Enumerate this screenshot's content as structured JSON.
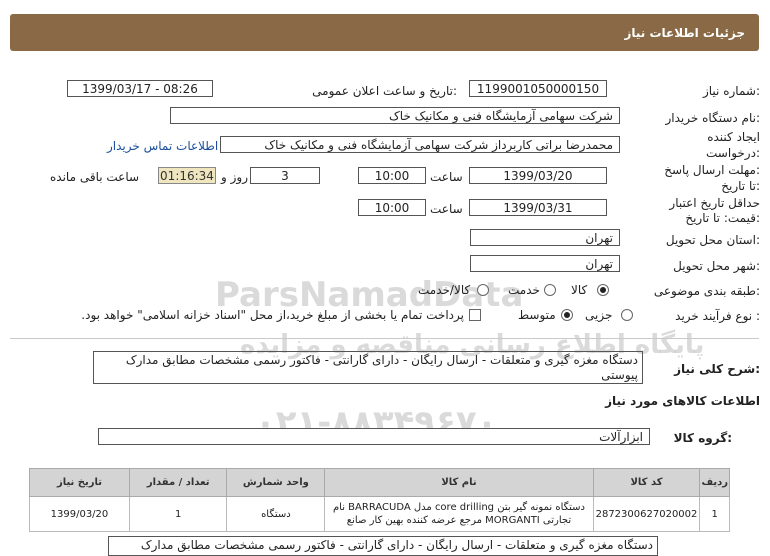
{
  "header": {
    "title": "جزئیات اطلاعات نیاز"
  },
  "fields": {
    "need_number": {
      "label": "شماره نیاز:",
      "value": "1199001050000150"
    },
    "announce_datetime": {
      "label": "تاریخ و ساعت اعلان عمومی:",
      "value": "1399/03/17 - 08:26"
    },
    "buyer_org": {
      "label": "نام دستگاه خریدار:",
      "value": "شرکت سهامی آزمایشگاه فنی و مکانیک خاک"
    },
    "requester": {
      "label_line1": "ایجاد کننده",
      "label_line2": "درخواست:",
      "value": "محمدرضا براتی کاربرداز  شرکت سهامی آزمایشگاه فنی و مکانیک خاک"
    },
    "buyer_contact_link": "اطلاعات تماس خریدار",
    "reply_deadline": {
      "label_line1": "مهلت ارسال پاسخ:",
      "label_line2": "تا تاریخ:",
      "date": "1399/03/20",
      "time_label": "ساعت",
      "time": "10:00",
      "days": "3",
      "days_label": "روز و",
      "remaining": "01:16:34",
      "remaining_label": "ساعت باقی مانده"
    },
    "price_validity": {
      "label_line1": "حداقل تاریخ اعتبار",
      "label_line2": "قیمت: تا تاریخ:",
      "date": "1399/03/31",
      "time_label": "ساعت",
      "time": "10:00"
    },
    "delivery_province": {
      "label": "استان محل تحویل:",
      "value": "تهران"
    },
    "delivery_city": {
      "label": "شهر محل تحویل:",
      "value": "تهران"
    },
    "category": {
      "label": "طبقه بندی موضوعی:",
      "options": [
        "کالا",
        "خدمت",
        "کالا/خدمت"
      ]
    },
    "purchase_process": {
      "label": "نوع فرآیند خرید :",
      "options": [
        "جزیی",
        "متوسط"
      ],
      "note": "پرداخت تمام یا بخشی از مبلغ خرید،از محل \"اسناد خزانه اسلامی\" خواهد بود."
    }
  },
  "description": {
    "label": "شرح کلی نیاز:",
    "value": "دستگاه  مغزه گیری و متعلقات - ارسال رایگان - دارای گارانتی - فاکتور رسمی مشخصات مطابق مدارک پیوستی"
  },
  "goods_info": {
    "title": "اطلاعات کالاهای مورد نیاز",
    "group_label": "گروه کالا:",
    "group_value": "ابزارآلات",
    "columns": [
      "ردیف",
      "کد کالا",
      "نام کالا",
      "واحد شمارش",
      "تعداد / مقدار",
      "تاریخ نیاز"
    ],
    "rows": [
      {
        "index": "1",
        "code": "2872300627020002",
        "name_line1": "دستگاه نمونه گیر بتن core drilling مدل BARRACUDA نام",
        "name_line2": "تجارتی MORGANTI مرجع عرضه کننده بهین کار صانع",
        "unit": "دستگاه",
        "qty": "1",
        "date": "1399/03/20"
      }
    ]
  },
  "bottom_partial": "دستگاه  مغزه گیری و متعلقات - ارسال رایگان - دارای گارانتی - فاکتور رسمی مشخصات مطابق مدارک",
  "watermark": {
    "line1": "ParsNamadData",
    "line2": "پایگاه اطلاع رسانی مناقصه و مزایده",
    "line3": "۰۲۱-۸۸۳۴۹۶۷۰"
  },
  "colors": {
    "header_bg": "#8a6a46",
    "timer_bg": "#efe6c0",
    "link": "#1a4f9c",
    "table_header_bg": "#d4d4d4"
  }
}
